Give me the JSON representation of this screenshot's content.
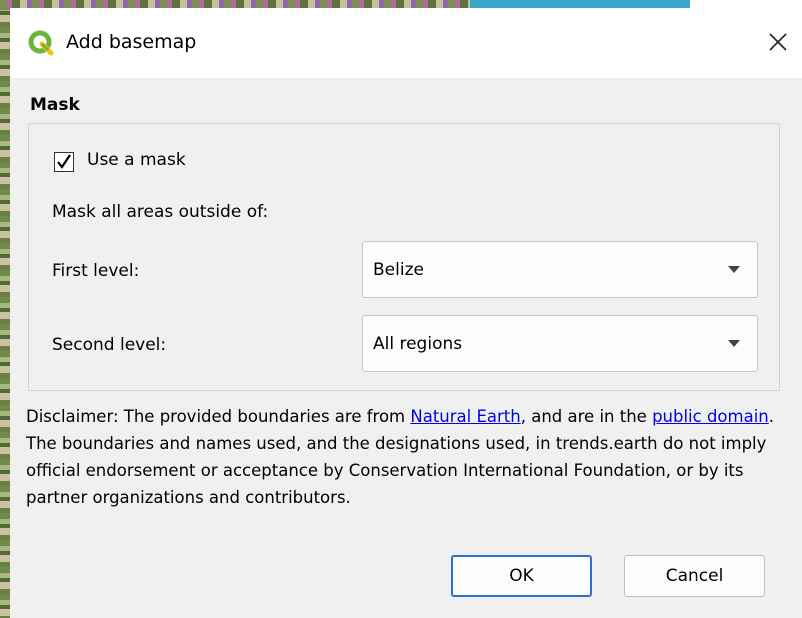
{
  "window": {
    "title": "Add basemap",
    "close_label": "✕"
  },
  "mask": {
    "section_title": "Mask",
    "use_mask_label": "Use a mask",
    "use_mask_checked": true,
    "outside_label": "Mask all areas outside of:",
    "first_level_label": "First level:",
    "first_level_value": "Belize",
    "second_level_label": "Second level:",
    "second_level_value": "All regions"
  },
  "disclaimer": {
    "part1": "Disclaimer: The provided boundaries are from ",
    "link1": "Natural Earth",
    "part2": ", and are in the ",
    "link2": "public domain",
    "part3": ". The boundaries and names used, and the designations used, in trends.earth do not imply official endorsement or acceptance by Conservation International Foundation, or by its partner organizations and contributors."
  },
  "buttons": {
    "ok": "OK",
    "cancel": "Cancel"
  },
  "colors": {
    "link": "#0000ee",
    "default_button_border": "#2f6fcf",
    "qgis_green": "#6db33f"
  }
}
